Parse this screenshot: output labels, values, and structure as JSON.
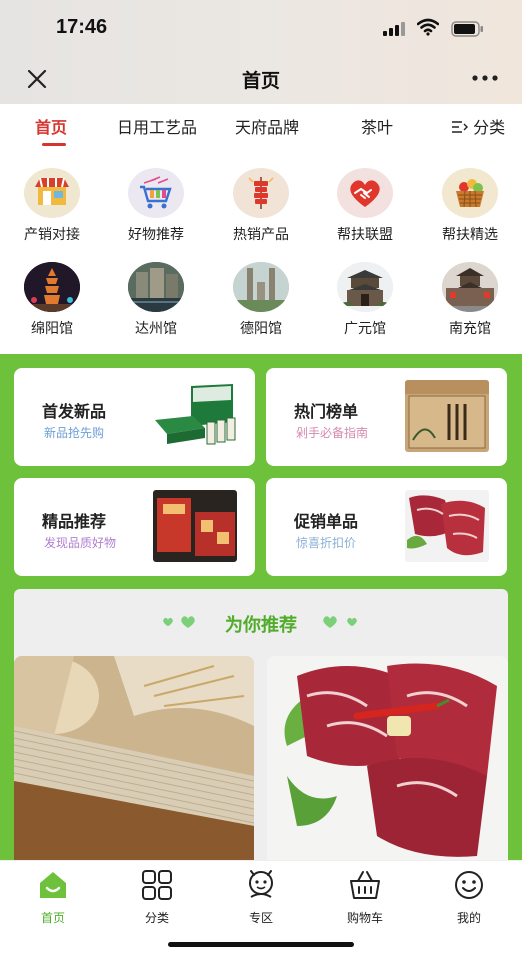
{
  "status_bar": {
    "time": "17:46"
  },
  "title_bar": {
    "title": "首页"
  },
  "tabs": [
    {
      "label": "首页",
      "active": true
    },
    {
      "label": "日用工艺品",
      "active": false
    },
    {
      "label": "天府品牌",
      "active": false
    },
    {
      "label": "茶叶",
      "active": false
    }
  ],
  "tabs_more": {
    "label": "分类"
  },
  "grid": [
    {
      "label": "产销对接",
      "icon": "market-stall-icon"
    },
    {
      "label": "好物推荐",
      "icon": "shopping-cart-icon"
    },
    {
      "label": "热销产品",
      "icon": "firecracker-icon"
    },
    {
      "label": "帮扶联盟",
      "icon": "handshake-heart-icon"
    },
    {
      "label": "帮扶精选",
      "icon": "fruit-basket-icon"
    },
    {
      "label": "绵阳馆",
      "icon": "mianyang-tower-icon"
    },
    {
      "label": "达州馆",
      "icon": "dazhou-city-icon"
    },
    {
      "label": "德阳馆",
      "icon": "deyang-statues-icon"
    },
    {
      "label": "广元馆",
      "icon": "guangyuan-gate-icon"
    },
    {
      "label": "南充馆",
      "icon": "nanchong-street-icon"
    }
  ],
  "promo_cards": [
    {
      "title": "首发新品",
      "subtitle": "新品抢先购",
      "subtitle_color": "#6b9fd6"
    },
    {
      "title": "热门榜单",
      "subtitle": "剁手必备指南",
      "subtitle_color": "#d48ab0"
    },
    {
      "title": "精品推荐",
      "subtitle": "发现品质好物",
      "subtitle_color": "#b07fd0"
    },
    {
      "title": "促销单品",
      "subtitle": "惊喜折扣价",
      "subtitle_color": "#8ab0d6"
    }
  ],
  "recommend": {
    "title": "为你推荐"
  },
  "bottom_nav": [
    {
      "label": "首页",
      "active": true,
      "icon": "home-icon"
    },
    {
      "label": "分类",
      "active": false,
      "icon": "category-grid-icon"
    },
    {
      "label": "专区",
      "active": false,
      "icon": "zone-mascot-icon"
    },
    {
      "label": "购物车",
      "active": false,
      "icon": "shopping-basket-icon"
    },
    {
      "label": "我的",
      "active": false,
      "icon": "smiley-face-icon"
    }
  ],
  "colors": {
    "accent_red": "#d6352f",
    "brand_green": "#6ec23b",
    "title_green": "#52ac2c"
  }
}
